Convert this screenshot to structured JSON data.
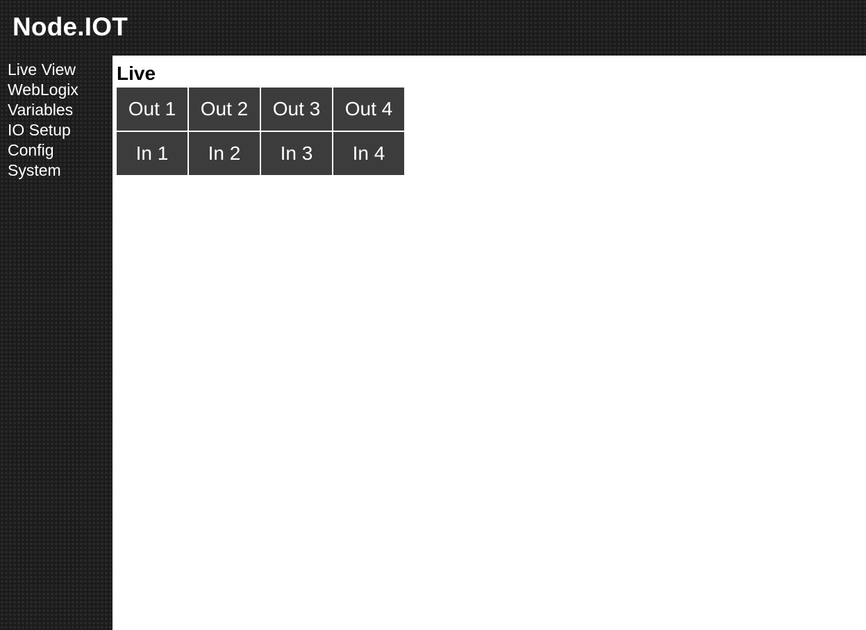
{
  "app": {
    "brand": "Node.IOT"
  },
  "sidebar": {
    "items": [
      {
        "label": "Live View"
      },
      {
        "label": "WebLogix"
      },
      {
        "label": "Variables"
      },
      {
        "label": "IO Setup"
      },
      {
        "label": "Config"
      },
      {
        "label": "System"
      }
    ]
  },
  "main": {
    "title": "Live",
    "outputs": [
      {
        "label": "Out 1"
      },
      {
        "label": "Out 2"
      },
      {
        "label": "Out 3"
      },
      {
        "label": "Out 4"
      }
    ],
    "inputs": [
      {
        "label": "In 1"
      },
      {
        "label": "In 2"
      },
      {
        "label": "In 3"
      },
      {
        "label": "In 4"
      }
    ]
  },
  "colors": {
    "background_pattern": "#1b1b1b",
    "tile": "#3c3c3c",
    "content_bg": "#ffffff",
    "text_light": "#ffffff",
    "text_dark": "#000000"
  }
}
